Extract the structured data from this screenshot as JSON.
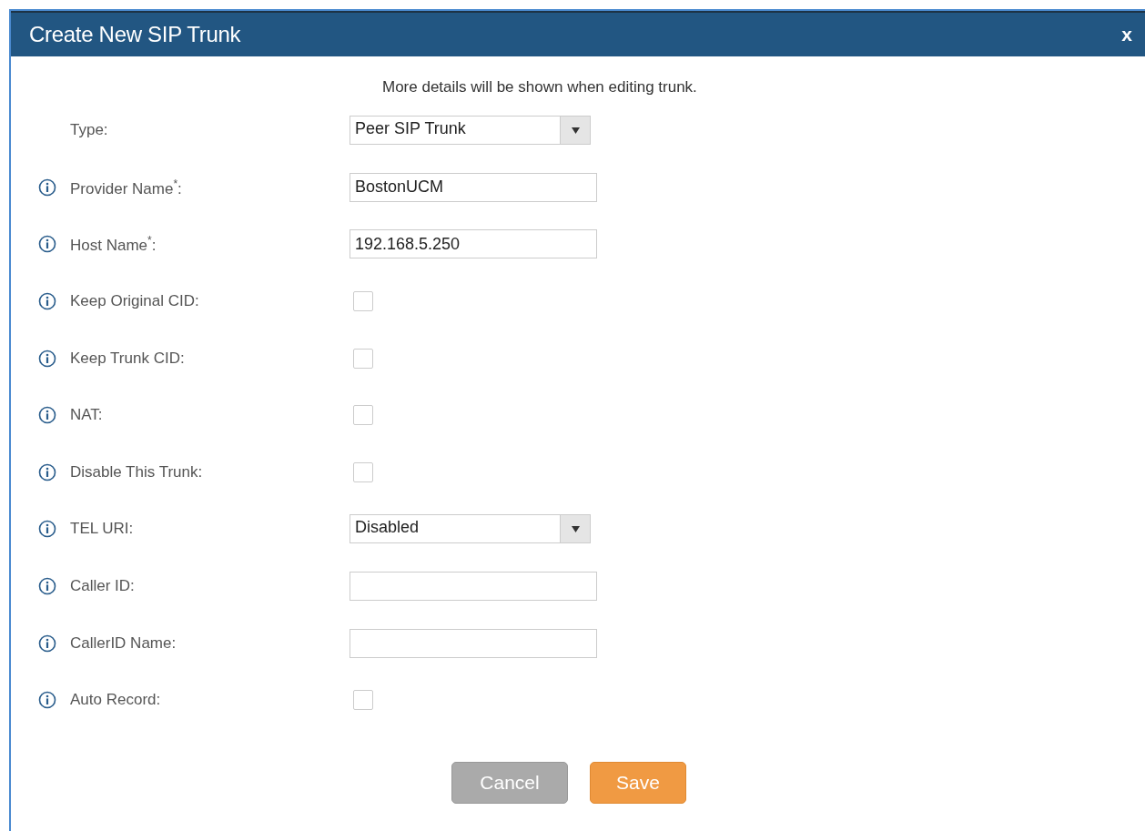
{
  "dialog": {
    "title": "Create New SIP Trunk",
    "close": "x",
    "note": "More details will be shown when editing trunk.",
    "fields": [
      {
        "kind": "select",
        "info": false,
        "label": "Type:",
        "value": "Peer SIP Trunk"
      },
      {
        "kind": "text",
        "info": true,
        "label": "Provider Name",
        "required_mark": "*",
        "suffix": ":",
        "value": "BostonUCM"
      },
      {
        "kind": "text",
        "info": true,
        "label": "Host Name",
        "required_mark": "*",
        "suffix": ":",
        "value": "192.168.5.250"
      },
      {
        "kind": "checkbox",
        "info": true,
        "label": "Keep Original CID:",
        "checked": false
      },
      {
        "kind": "checkbox",
        "info": true,
        "label": "Keep Trunk CID:",
        "checked": false
      },
      {
        "kind": "checkbox",
        "info": true,
        "label": "NAT:",
        "checked": false
      },
      {
        "kind": "checkbox",
        "info": true,
        "label": "Disable This Trunk:",
        "checked": false
      },
      {
        "kind": "select",
        "info": true,
        "label": "TEL URI:",
        "value": "Disabled"
      },
      {
        "kind": "text",
        "info": true,
        "label": "Caller ID:"
      },
      {
        "kind": "text",
        "info": true,
        "label": "CallerID Name:"
      },
      {
        "kind": "checkbox",
        "info": true,
        "label": "Auto Record:",
        "checked": false
      }
    ],
    "buttons": [
      {
        "kind": "cancel",
        "label": "Cancel"
      },
      {
        "kind": "save",
        "label": "Save"
      }
    ]
  }
}
